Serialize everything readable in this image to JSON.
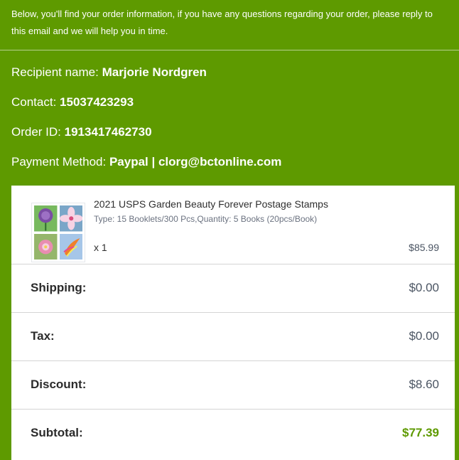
{
  "colors": {
    "brand_green": "#5e9a00",
    "card_bg": "#ffffff",
    "text_dark": "#2b2b2b",
    "text_muted": "#6b7280",
    "accent_total": "#5e9a00"
  },
  "intro": {
    "text": "Below, you'll find your order information, if you have any questions regarding your order, please reply to this email and we will help you in time."
  },
  "order": {
    "recipient_label": "Recipient name: ",
    "recipient_value": "Marjorie Nordgren",
    "contact_label": "Contact: ",
    "contact_value": "15037423293",
    "order_id_label": "Order ID: ",
    "order_id_value": "1913417462730",
    "payment_label": "Payment Method: ",
    "payment_value": "Paypal | clorg@bctonline.com"
  },
  "product": {
    "title": "2021 USPS Garden Beauty Forever Postage Stamps",
    "variant": "Type: 15 Booklets/300 Pcs,Quantity: 5 Books (20pcs/Book)",
    "quantity": "x 1",
    "price": "$85.99",
    "image_icon": "stamp-thumbnail-icon"
  },
  "summary": {
    "shipping_label": "Shipping:",
    "shipping_value": "$0.00",
    "tax_label": "Tax:",
    "tax_value": "$0.00",
    "discount_label": "Discount:",
    "discount_value": "$8.60",
    "subtotal_label": "Subtotal:",
    "subtotal_value": "$77.39"
  }
}
